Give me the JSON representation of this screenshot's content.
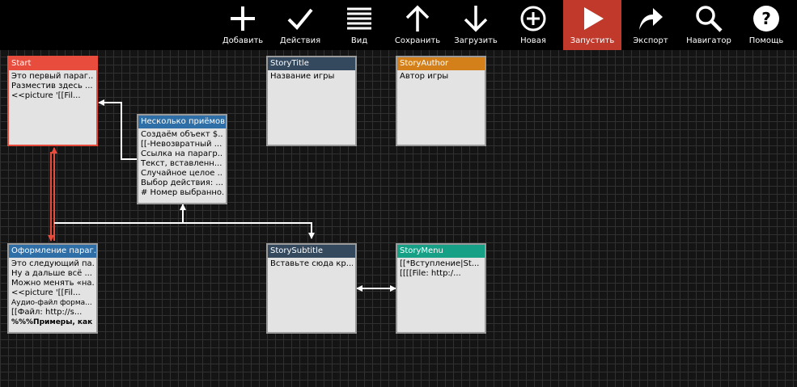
{
  "toolbar": {
    "buttons": [
      {
        "label": "Добавить",
        "icon": "plus-icon"
      },
      {
        "label": "Действия",
        "icon": "checkmark-icon"
      },
      {
        "label": "Вид",
        "icon": "list-icon"
      },
      {
        "label": "Сохранить",
        "icon": "arrow-up-icon"
      },
      {
        "label": "Загрузить",
        "icon": "arrow-down-icon"
      },
      {
        "label": "Новая",
        "icon": "plus-circle-icon"
      },
      {
        "label": "Запустить",
        "icon": "play-icon"
      },
      {
        "label": "Экспорт",
        "icon": "share-arrow-icon"
      },
      {
        "label": "Навигатор",
        "icon": "magnifier-icon"
      },
      {
        "label": "Помощь",
        "icon": "question-icon"
      }
    ],
    "active_button": "Запустить",
    "active_color": "#c0392b"
  },
  "passages": {
    "start": {
      "title": "Start",
      "color": "#e74c3c",
      "lines": [
        "Это первый параг...",
        "Разместив здесь ...",
        "<<picture '[[Fil..."
      ]
    },
    "story_title": {
      "title": "StoryTitle",
      "color": "#34495e",
      "lines": [
        "Название игры"
      ]
    },
    "story_author": {
      "title": "StoryAuthor",
      "color": "#d4801a",
      "lines": [
        "Автор игры"
      ]
    },
    "tricks": {
      "title": "Несколько приёмов",
      "color": "#2e6fa7",
      "lines": [
        "Создаём объект $...",
        "[[-Невозвратный ...",
        "Ссылка на парагр...",
        "Текст, вставленн...",
        "Случайное целое ...",
        "Выбор действия: ...",
        "# Номер выбранно..."
      ]
    },
    "formatting": {
      "title": "Оформление параг...",
      "color": "#2e6fa7",
      "lines": [
        "Это следующий па...",
        "Ну а дальше всё ...",
        "Можно менять «на...",
        "<<picture '[[Fil...",
        "Аудио-файл форма...",
        "[[Файл: http://s...",
        "%%%Примеры, как ..."
      ]
    },
    "story_subtitle": {
      "title": "StorySubtitle",
      "color": "#34495e",
      "lines": [
        "Вставьте сюда кр..."
      ]
    },
    "story_menu": {
      "title": "StoryMenu",
      "color": "#16a085",
      "lines": [
        "[[*Вступление|St...",
        "[[[[File: http:/..."
      ]
    }
  }
}
